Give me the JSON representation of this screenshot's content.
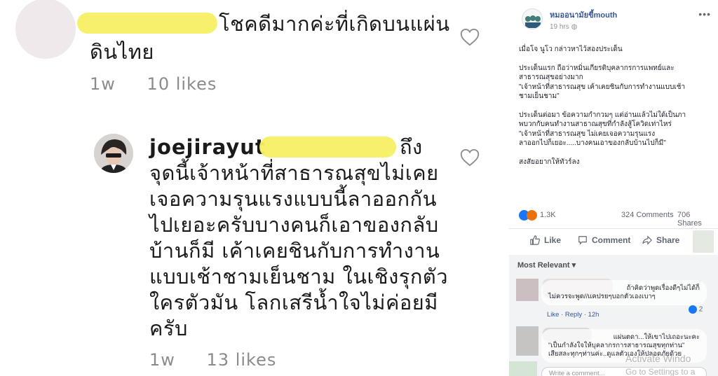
{
  "ig": {
    "comment1": {
      "text_line1": "โชคดีมากค่ะที่เกิดบนแผ่น",
      "text_line2": "ดินไทย",
      "time": "1w",
      "likes": "10 likes"
    },
    "comment2": {
      "username": "joejirayut",
      "line1_end": "ถึง",
      "lines": [
        "จุดนี้เจ้าหน้าที่สาธารณสุขไม่เคย",
        "เจอความรุนแรงแบบนี้ลาออกกัน",
        "ไปเยอะครับบางคนก็เอาของกลับ",
        "บ้านก็มี  เค้าเคยชินกับการทำงาน",
        "แบบเช้าชามเย็นชาม  ในเชิงรุกตัว",
        "ใครตัวมัน  โลกเสรีน้ำใจไม่ค่อยมี",
        "ครับ"
      ],
      "time": "1w",
      "likes": "13 likes"
    },
    "icons": {
      "heart": "heart-icon"
    }
  },
  "fb": {
    "page_name": "หมออนามัยขี้mouth",
    "time": "19 hrs",
    "more": "•••",
    "body": [
      "เมื่อโจ นูโว กล่าวหาไว้สองประเด็น",
      "ประเด็นแรก ถือว่าหมิ่นเกียรติบุคลากรการแพทย์และ\nสาธารณสุขอย่างมาก\n\"เจ้าหน้าที่สาธารณสุข เค้าเคยชินกับการทำงานแบบเช้า\nชามเย็นชาม\"",
      "ประเด็นต่อมา ข้อความกำกวมๆ แต่อ่านแล้วไม่ใด้เป็นภา\nพบวกกับคนทำงานสาธาณสุขที่กำลังสู้โควิดเท่าไหร่\n\"เจ้าหน้าที่สาธารณสุข ไม่เคยเจอความรุนแรง\nลาออกไปก็เยอะ.....บางคนเอาของกลับบ้านไปก็มี\"",
      "สงสัยอยากให้ทัวร์ลง"
    ],
    "reactions_count": "1.3K",
    "comments_count": "324 Comments",
    "shares_count": "706 Shares",
    "actions": {
      "like": "Like",
      "comment": "Comment",
      "share": "Share"
    },
    "sort_label": "Most Relevant",
    "comments": [
      {
        "line1": "ถ้าคิดว่าพูดเรื่องดีๆไม่ได้ก็",
        "line2": "ไม่ควรจะพูด//แคปรยๆบอกตัวเองเบาๆ",
        "reactions": "2",
        "links": "Like · Reply · 12h"
      },
      {
        "line1": "แผ่นตดา...ให้เขาไปเถอะนะคะ",
        "line2": "\"เป็นกำลังใจให้บุคลากรการสาธารณสุขทุกท่าน\"",
        "line3": "เสียสละทุกๆท่านค่ะ..ดูแลตัวเองให้ปลอดภัยด้วย"
      }
    ],
    "write_placeholder": "Write a comment...",
    "watermark_1": "Activate Windo",
    "watermark_2": "Go to Settings to a"
  }
}
